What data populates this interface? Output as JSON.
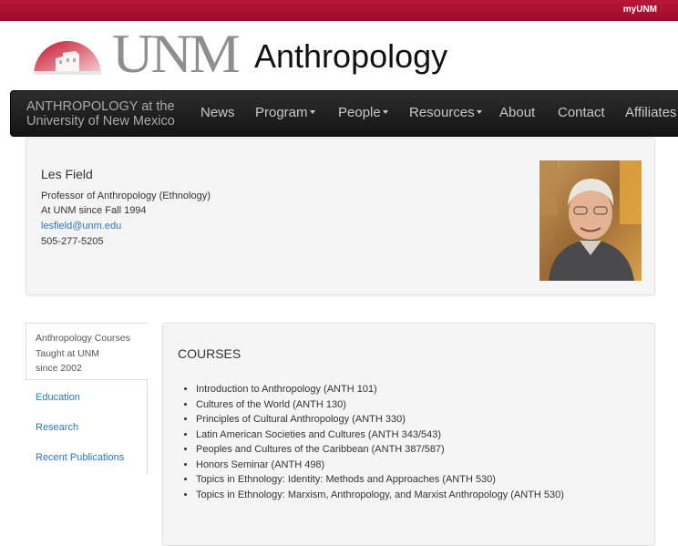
{
  "topbar": {
    "link": "myUNM"
  },
  "logo": {
    "unm": "UNM",
    "department": "Anthropology"
  },
  "nav": {
    "brand_line1": "ANTHROPOLOGY at the",
    "brand_line2": "University of New Mexico",
    "items": [
      {
        "label": "News",
        "dropdown": false
      },
      {
        "label": "Program",
        "dropdown": true
      },
      {
        "label": "People",
        "dropdown": true
      },
      {
        "label": "Resources",
        "dropdown": true
      },
      {
        "label": "About",
        "dropdown": false
      },
      {
        "label": "Contact",
        "dropdown": false
      },
      {
        "label": "Affiliates",
        "dropdown": false
      }
    ]
  },
  "profile": {
    "name": "Les Field",
    "title": "Professor of Anthropology (Ethnology)",
    "since": "At UNM since Fall 1994",
    "email": "lesfield@unm.edu",
    "phone": "505-277-5205"
  },
  "sidebar": {
    "active_line1": "Anthropology Courses",
    "active_line2": "Taught at UNM",
    "active_line3": "since 2002",
    "links": [
      "Education",
      "Research",
      "Recent Publications"
    ]
  },
  "courses": {
    "title": "COURSES",
    "items": [
      "Introduction to Anthropology (ANTH 101)",
      "Cultures of the World (ANTH 130)",
      "Principles of Cultural Anthropology (ANTH 330)",
      "Latin American Societies and Cultures (ANTH 343/543)",
      "Peoples and Cultures of the Caribbean (ANTH 387/587)",
      "Honors Seminar (ANTH 498)",
      "Topics in Ethnology: Identity: Methods and Approaches (ANTH 530)",
      "Topics in Ethnology: Marxism, Anthropology, and Marxist Anthropology (ANTH 530)"
    ]
  },
  "colors": {
    "topbar": "#ba0c2f",
    "navbar": "#1e1e1e",
    "link": "#2a77c6",
    "panel": "#f5f5f5"
  }
}
